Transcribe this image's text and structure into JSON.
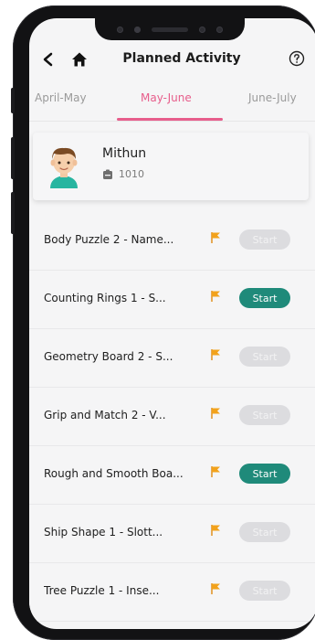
{
  "header": {
    "title": "Planned Activity"
  },
  "tabs": [
    {
      "label": "April-May",
      "active": false
    },
    {
      "label": "May-June",
      "active": true
    },
    {
      "label": "June-July",
      "active": false
    }
  ],
  "profile": {
    "name": "Mithun",
    "id": "1010"
  },
  "activities": [
    {
      "label": "Body Puzzle 2 - Name...",
      "start_label": "Start",
      "enabled": false
    },
    {
      "label": "Counting Rings 1 - S...",
      "start_label": "Start",
      "enabled": true
    },
    {
      "label": "Geometry Board 2 - S...",
      "start_label": "Start",
      "enabled": false
    },
    {
      "label": "Grip and Match 2 - V...",
      "start_label": "Start",
      "enabled": false
    },
    {
      "label": "Rough and Smooth Boa...",
      "start_label": "Start",
      "enabled": true
    },
    {
      "label": "Ship Shape 1 - Slott...",
      "start_label": "Start",
      "enabled": false
    },
    {
      "label": "Tree Puzzle 1 - Inse...",
      "start_label": "Start",
      "enabled": false
    }
  ],
  "colors": {
    "accent_pink": "#e75d8b",
    "start_enabled": "#1f8a7a",
    "start_disabled": "#dcdcdf",
    "flag": "#f2a21b"
  },
  "icons": {
    "back": "back-arrow-icon",
    "home": "home-icon",
    "help": "help-circle-icon",
    "flag": "flag-icon",
    "id": "id-badge-icon"
  }
}
